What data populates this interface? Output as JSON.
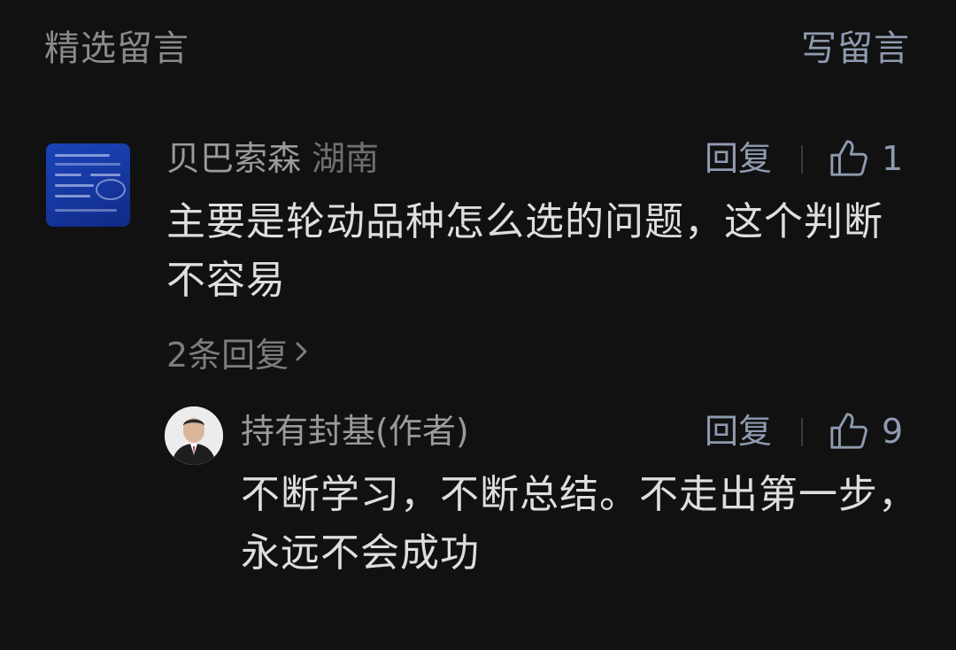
{
  "header": {
    "title": "精选留言",
    "write_label": "写留言"
  },
  "comments": [
    {
      "author": "贝巴索森",
      "location": "湖南",
      "reply_label": "回复",
      "likes": "1",
      "text": "主要是轮动品种怎么选的问题，这个判断不容易",
      "replies_link": "2条回复",
      "avatar_icon": "chart-thumbnail"
    }
  ],
  "author_reply": {
    "author": "持有封基(作者)",
    "reply_label": "回复",
    "likes": "9",
    "text": "不断学习，不断总结。不走出第一步，永远不会成功",
    "avatar_icon": "person-photo"
  },
  "colors": {
    "background": "#111111",
    "link": "#8e9bb0",
    "body_text": "#dedede",
    "muted": "#8a8a8a"
  }
}
